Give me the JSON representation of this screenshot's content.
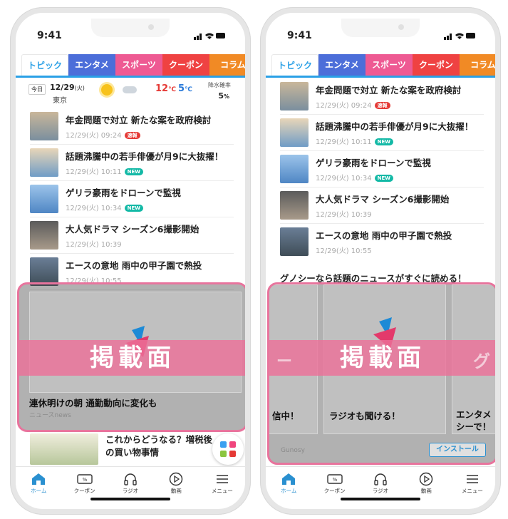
{
  "status_time": "9:41",
  "status_icons": "..ıl ⌔ ▬",
  "tabs": [
    "トピック",
    "エンタメ",
    "スポーツ",
    "クーポン",
    "コラム"
  ],
  "weather": {
    "today": "今日",
    "date": "12/29",
    "weekday": "(火)",
    "city": "東京",
    "high": "12",
    "high_unit": "℃",
    "low": "5",
    "low_unit": "℃",
    "rain_label": "降水確率",
    "rain_value": "5",
    "rain_unit": "%"
  },
  "news": [
    {
      "title": "年金問題で対立 新たな案を政府検討",
      "time": "12/29(火) 09:24",
      "badge": "速報",
      "badge_type": "sokuho"
    },
    {
      "title": "話題沸騰中の若手俳優が月9に大抜擢！",
      "time": "12/29(火) 10:11",
      "badge": "NEW",
      "badge_type": "new"
    },
    {
      "title": "ゲリラ豪雨をドローンで監視",
      "time": "12/29(火) 10:34",
      "badge": "NEW",
      "badge_type": "new"
    },
    {
      "title": "大人気ドラマ シーズン6撮影開始",
      "time": "12/29(火) 10:39",
      "badge": "",
      "badge_type": ""
    },
    {
      "title": "エースの意地 雨中の甲子園で熱投",
      "time": "12/29(火) 10:55",
      "badge": "",
      "badge_type": ""
    }
  ],
  "ad_label": "掲載面",
  "ad_left": {
    "title": "連休明けの朝 通勤動向に変化も",
    "source": "ニュースnews"
  },
  "extra_article": "これからどうなる？増税後の買い物事情",
  "tagline": "グノシーなら話題のニュースがすぐに読める！",
  "ad_right": {
    "cards": [
      "信中！",
      "ラジオも聞ける！",
      "エンタメシーで！"
    ],
    "partial": "グ",
    "left_partial": "ー",
    "source": "Gunosy",
    "install": "インストール"
  },
  "nav": [
    "ホーム",
    "クーポン",
    "ラジオ",
    "動画",
    "メニュー"
  ],
  "colors": {
    "accent": "#2aa0e6",
    "ad_border": "#e8749d",
    "ad_band": "#ec7099"
  }
}
